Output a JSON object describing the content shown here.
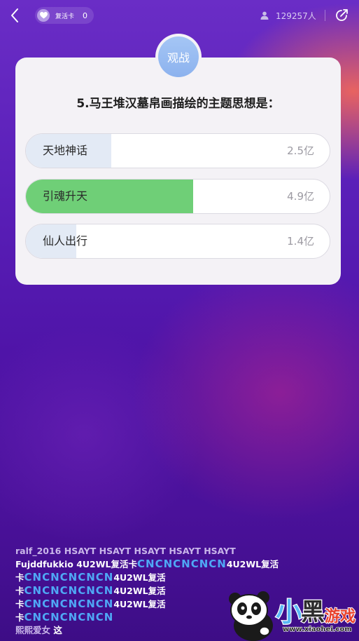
{
  "topbar": {
    "revive_label": "复活卡",
    "revive_count": "0",
    "online_count": "129257人"
  },
  "card": {
    "watch_label": "观战",
    "question": "5.马王堆汉墓帛画描绘的主题思想是：",
    "options": [
      {
        "label": "天地神话",
        "votes": "2.5亿",
        "share": 0.28,
        "correct": false
      },
      {
        "label": "引魂升天",
        "votes": "4.9亿",
        "share": 0.55,
        "correct": true
      },
      {
        "label": "仙人出行",
        "votes": "1.4亿",
        "share": 0.165,
        "correct": false
      }
    ]
  },
  "chat": {
    "line1": {
      "user": "ralf_2016",
      "text": "HSAYT HSAYT HSAYT HSAYT HSAYT"
    },
    "line2": {
      "user": "Fujddfukkio",
      "text_a": "4U2WL复活卡",
      "cn": "CNCNCNCNCN",
      "text_b": "4U2WL复活"
    },
    "line3": {
      "pre": "卡",
      "cn": "CNCNCNCNCN",
      "text": "4U2WL复活"
    },
    "line4": {
      "pre": "卡",
      "cn": "CNCNCNCNCN",
      "text": "4U2WL复活"
    },
    "line5": {
      "pre": "卡",
      "cn": "CNCNCNCNCN",
      "text": "4U2WL复活"
    },
    "line6": {
      "pre": "卡",
      "cn": "CNCNCNCNCN"
    },
    "line7": {
      "user": "熙熙爱女",
      "text": "这"
    }
  },
  "watermark": {
    "brand": "小黑游戏",
    "url": "www.xiaohei.com"
  },
  "colors": {
    "correct": "#6fcf77",
    "normal_fill": "#e3eaf5",
    "watch": "#98bcf2",
    "cn_text": "#4fa8f5"
  }
}
